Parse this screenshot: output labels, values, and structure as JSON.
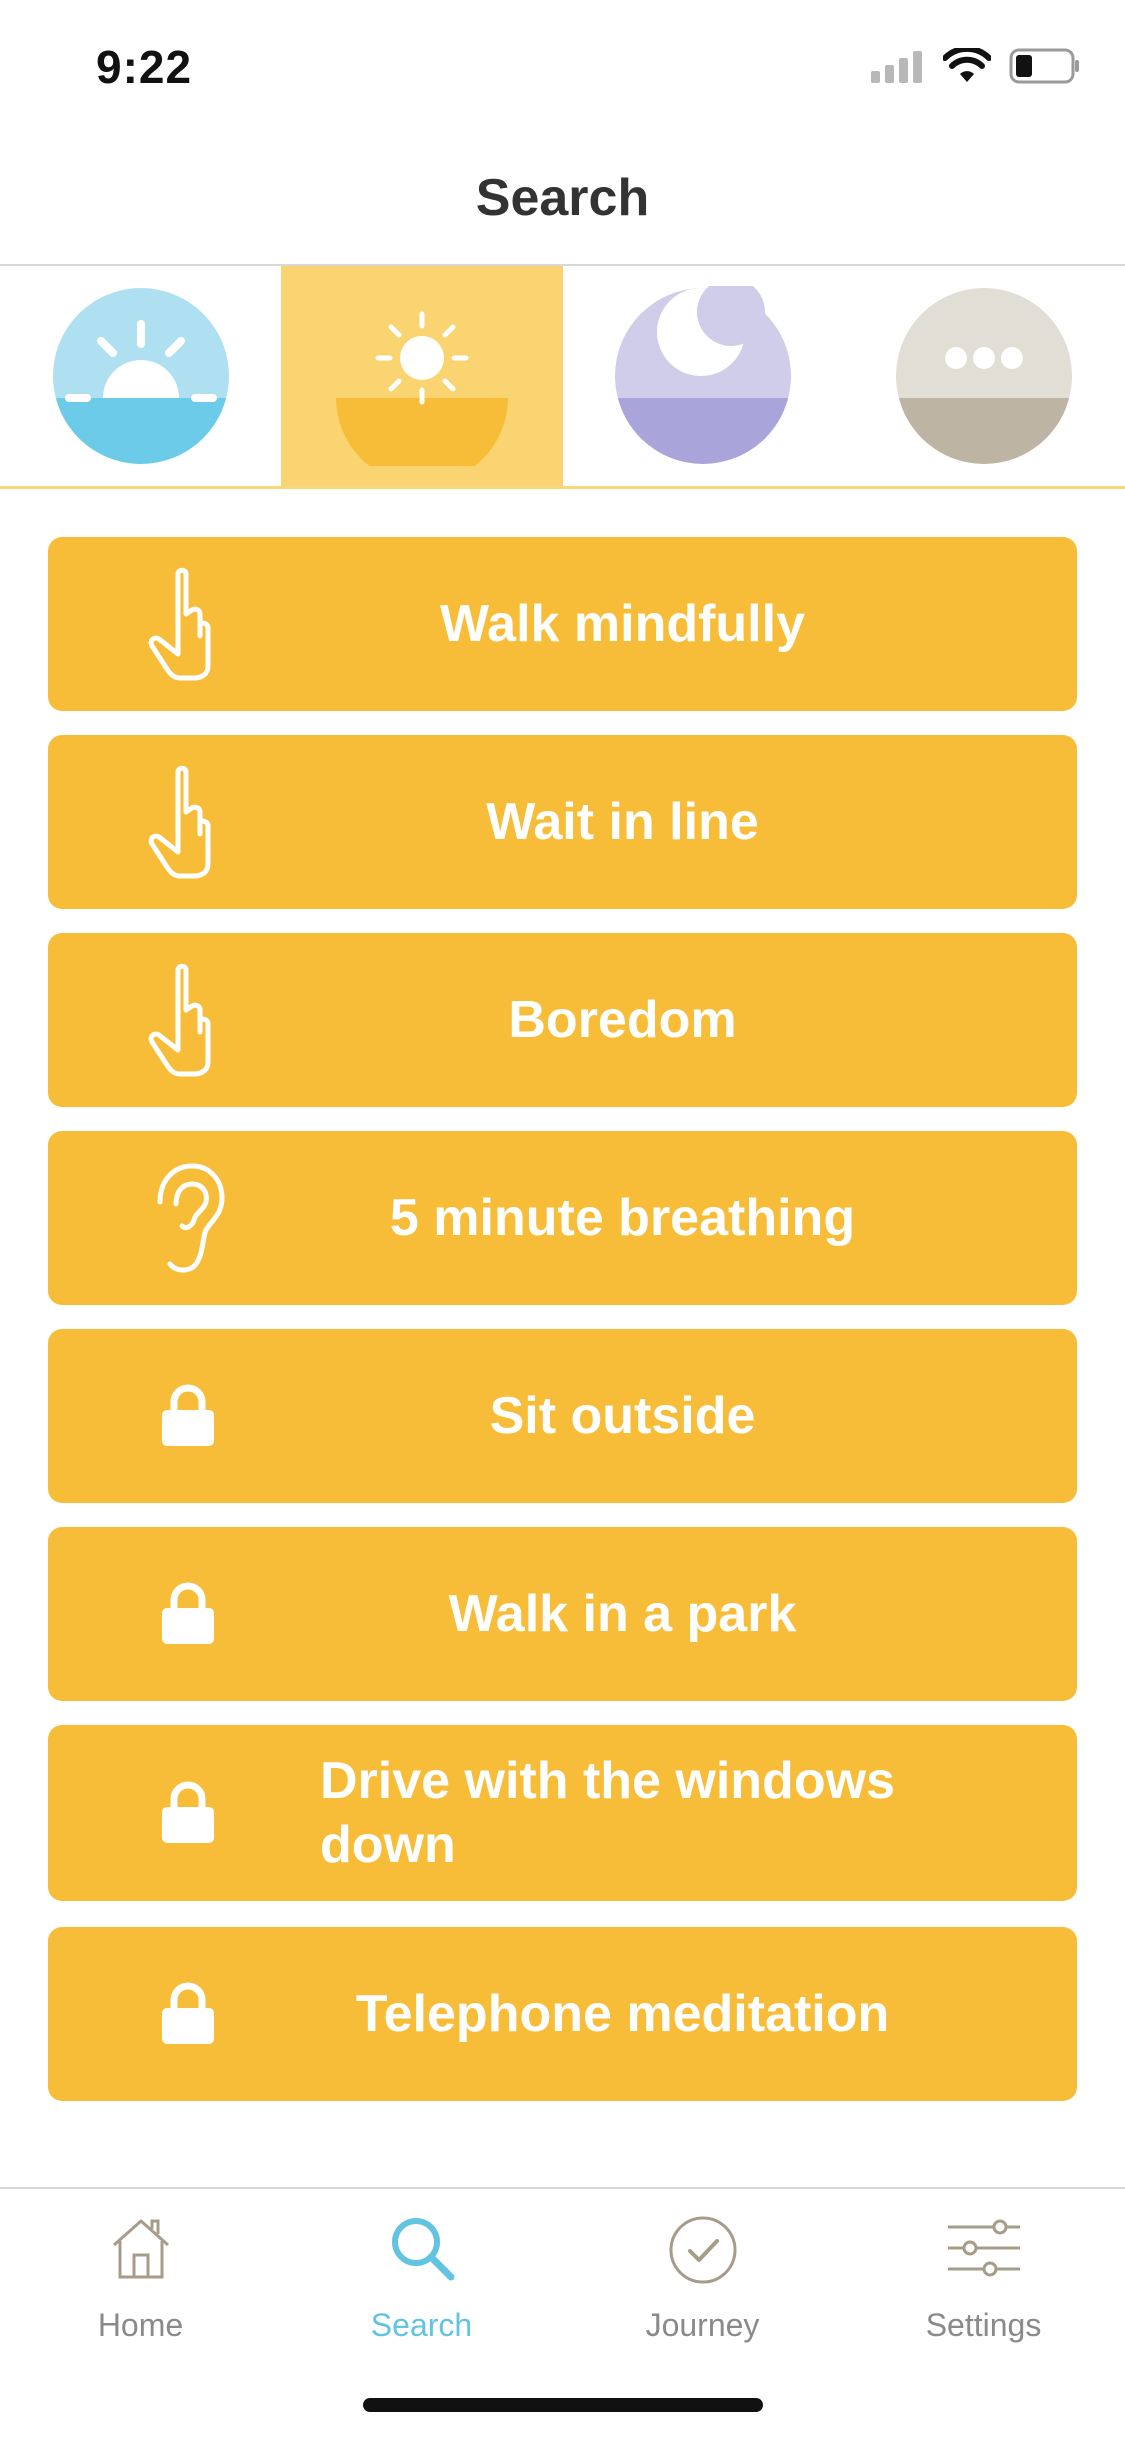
{
  "status": {
    "time": "9:22"
  },
  "nav": {
    "title": "Search"
  },
  "categories": [
    {
      "name": "sunrise",
      "selected": false,
      "colors": {
        "top": "#aee0f2",
        "bottom": "#6ccbe8"
      }
    },
    {
      "name": "day",
      "selected": true,
      "colors": {
        "top": "#f9d471",
        "bottom": "#f8bd38"
      }
    },
    {
      "name": "night",
      "selected": false,
      "colors": {
        "top": "#cfcdea",
        "bottom": "#a9a4da"
      }
    },
    {
      "name": "more",
      "selected": false,
      "colors": {
        "top": "#e1ded6",
        "bottom": "#bdb4a3"
      }
    }
  ],
  "items": [
    {
      "label": "Walk mindfully",
      "icon": "hand-pointer-icon"
    },
    {
      "label": "Wait in line",
      "icon": "hand-pointer-icon"
    },
    {
      "label": "Boredom",
      "icon": "hand-pointer-icon"
    },
    {
      "label": "5 minute breathing",
      "icon": "ear-icon"
    },
    {
      "label": "Sit outside",
      "icon": "lock-icon"
    },
    {
      "label": "Walk in a park",
      "icon": "lock-icon"
    },
    {
      "label": "Drive with the windows down",
      "icon": "lock-icon"
    },
    {
      "label": "Telephone meditation",
      "icon": "lock-icon"
    }
  ],
  "tabbar": {
    "home": "Home",
    "search": "Search",
    "journey": "Journey",
    "settings": "Settings",
    "active": "search",
    "accent": "#62c3e3"
  },
  "accent": "#f8bd38"
}
